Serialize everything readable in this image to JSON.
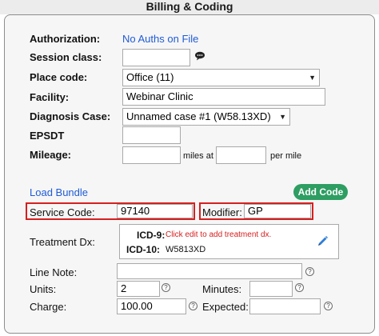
{
  "title": "Billing & Coding",
  "authorization": {
    "label": "Authorization:",
    "link": "No Auths on File"
  },
  "session_class": {
    "label": "Session class:",
    "value": ""
  },
  "place_code": {
    "label": "Place code:",
    "value": "Office (11)"
  },
  "facility": {
    "label": "Facility:",
    "value": "Webinar Clinic"
  },
  "diagnosis_case": {
    "label": "Diagnosis Case:",
    "value": "Unnamed case #1 (W58.13XD)"
  },
  "epsdt": {
    "label": "EPSDT",
    "value": ""
  },
  "mileage": {
    "label": "Mileage:",
    "miles_value": "",
    "miles_at": "miles at",
    "per_mile_value": "",
    "per_mile": "per mile"
  },
  "load_bundle": "Load Bundle",
  "add_code": "Add Code",
  "service_code": {
    "label": "Service Code:",
    "value": "97140"
  },
  "modifier": {
    "label": "Modifier:",
    "value": "GP"
  },
  "treatment_dx": {
    "label": "Treatment Dx:",
    "icd9_label": "ICD-9:",
    "icd9_value": "Click edit to add treatment dx.",
    "icd10_label": "ICD-10:",
    "icd10_value": "W5813XD"
  },
  "line_note": {
    "label": "Line Note:",
    "value": ""
  },
  "units": {
    "label": "Units:",
    "value": "2"
  },
  "minutes": {
    "label": "Minutes:",
    "value": ""
  },
  "charge": {
    "label": "Charge:",
    "value": "100.00"
  },
  "expected": {
    "label": "Expected:",
    "value": ""
  },
  "icons": {
    "chat": "chat-bubble-icon",
    "help": "help-circle-icon",
    "edit": "pencil-icon",
    "dropdown": "chevron-down-icon"
  },
  "colors": {
    "link": "#1f5bd6",
    "add_button": "#2e9e62",
    "highlight": "#d61f1f",
    "dx_hint": "#d61f1f"
  }
}
